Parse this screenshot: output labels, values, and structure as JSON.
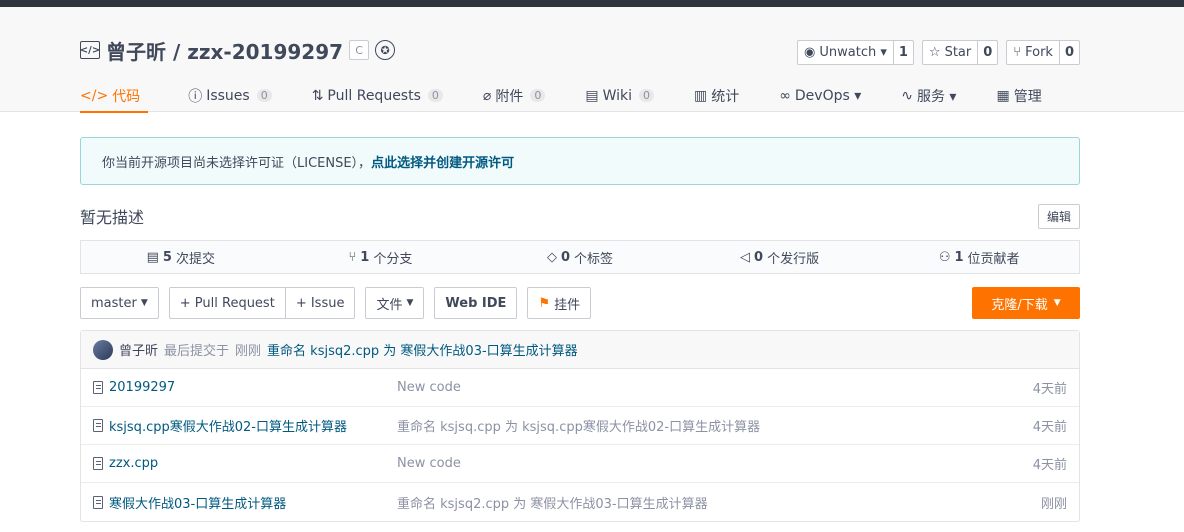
{
  "header": {
    "owner": "曾子昕",
    "separator": " / ",
    "repo": "zzx-20199297",
    "lang_badge": "C",
    "actions": [
      {
        "icon": "eye-icon",
        "label": "Unwatch ▾",
        "count": "1"
      },
      {
        "icon": "star-icon",
        "label": "Star",
        "count": "0"
      },
      {
        "icon": "fork-icon",
        "label": "Fork",
        "count": "0"
      }
    ],
    "tabs": [
      {
        "icon": "code-icon",
        "label": "代码",
        "badge": ""
      },
      {
        "icon": "issues-icon",
        "label": "Issues",
        "badge": "0"
      },
      {
        "icon": "pull-request-icon",
        "label": "Pull Requests",
        "badge": "0"
      },
      {
        "icon": "attachment-icon",
        "label": "附件",
        "badge": "0"
      },
      {
        "icon": "wiki-icon",
        "label": "Wiki",
        "badge": "0"
      },
      {
        "icon": "stats-icon",
        "label": "统计",
        "badge": ""
      },
      {
        "icon": "devops-icon",
        "label": "DevOps ▾",
        "badge": ""
      },
      {
        "icon": "service-icon",
        "label": "服务 ▾",
        "badge": ""
      },
      {
        "icon": "manage-icon",
        "label": "管理",
        "badge": ""
      }
    ]
  },
  "license": {
    "text": "你当前开源项目尚未选择许可证（LICENSE），",
    "link": "点此选择并创建开源许可"
  },
  "description": {
    "text": "暂无描述",
    "edit": "编辑"
  },
  "stats": [
    {
      "icon": "commit-icon",
      "count": "5",
      "label": "次提交"
    },
    {
      "icon": "branch-icon",
      "count": "1",
      "label": "个分支"
    },
    {
      "icon": "tag-icon",
      "count": "0",
      "label": "个标签"
    },
    {
      "icon": "release-icon",
      "count": "0",
      "label": "个发行版"
    },
    {
      "icon": "contributors-icon",
      "count": "1",
      "label": "位贡献者"
    }
  ],
  "toolbar": {
    "branch": "master",
    "pull_request": "+ Pull Request",
    "issue": "+ Issue",
    "file": "文件",
    "web_ide": "Web IDE",
    "bookmark": "挂件",
    "clone": "克隆/下载"
  },
  "last_commit": {
    "author": "曾子昕",
    "prefix": "最后提交于",
    "time": "刚刚",
    "message": "重命名 ksjsq2.cpp 为 寒假大作战03-口算生成计算器"
  },
  "files": [
    {
      "name": "20199297",
      "message": "New code",
      "time": "4天前"
    },
    {
      "name": "ksjsq.cpp寒假大作战02-口算生成计算器",
      "message": "重命名 ksjsq.cpp 为 ksjsq.cpp寒假大作战02-口算生成计算器",
      "time": "4天前"
    },
    {
      "name": "zzx.cpp",
      "message": "New code",
      "time": "4天前"
    },
    {
      "name": "寒假大作战03-口算生成计算器",
      "message": "重命名 ksjsq2.cpp 为 寒假大作战03-口算生成计算器",
      "time": "刚刚"
    }
  ]
}
